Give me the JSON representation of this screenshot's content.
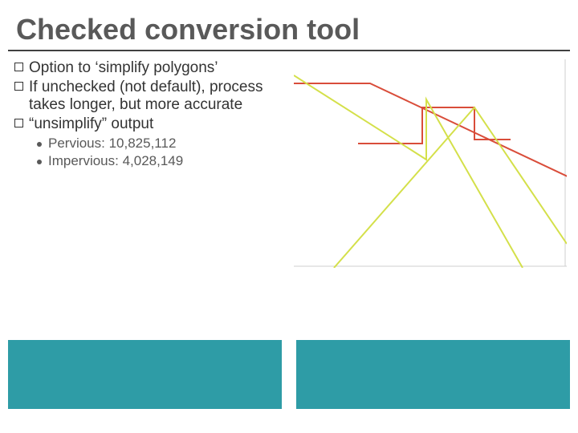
{
  "title": "Checked conversion tool",
  "bullets": [
    "Option to ‘simplify polygons’",
    "If unchecked (not default), process takes longer, but more accurate",
    "“unsimplify” output"
  ],
  "sub_bullets": [
    "Pervious: 10,825,112",
    "Impervious: 4,028,149"
  ],
  "figure": {
    "lines": {
      "red_color": "#d94d3a",
      "yellow_color": "#d4e04a"
    }
  }
}
